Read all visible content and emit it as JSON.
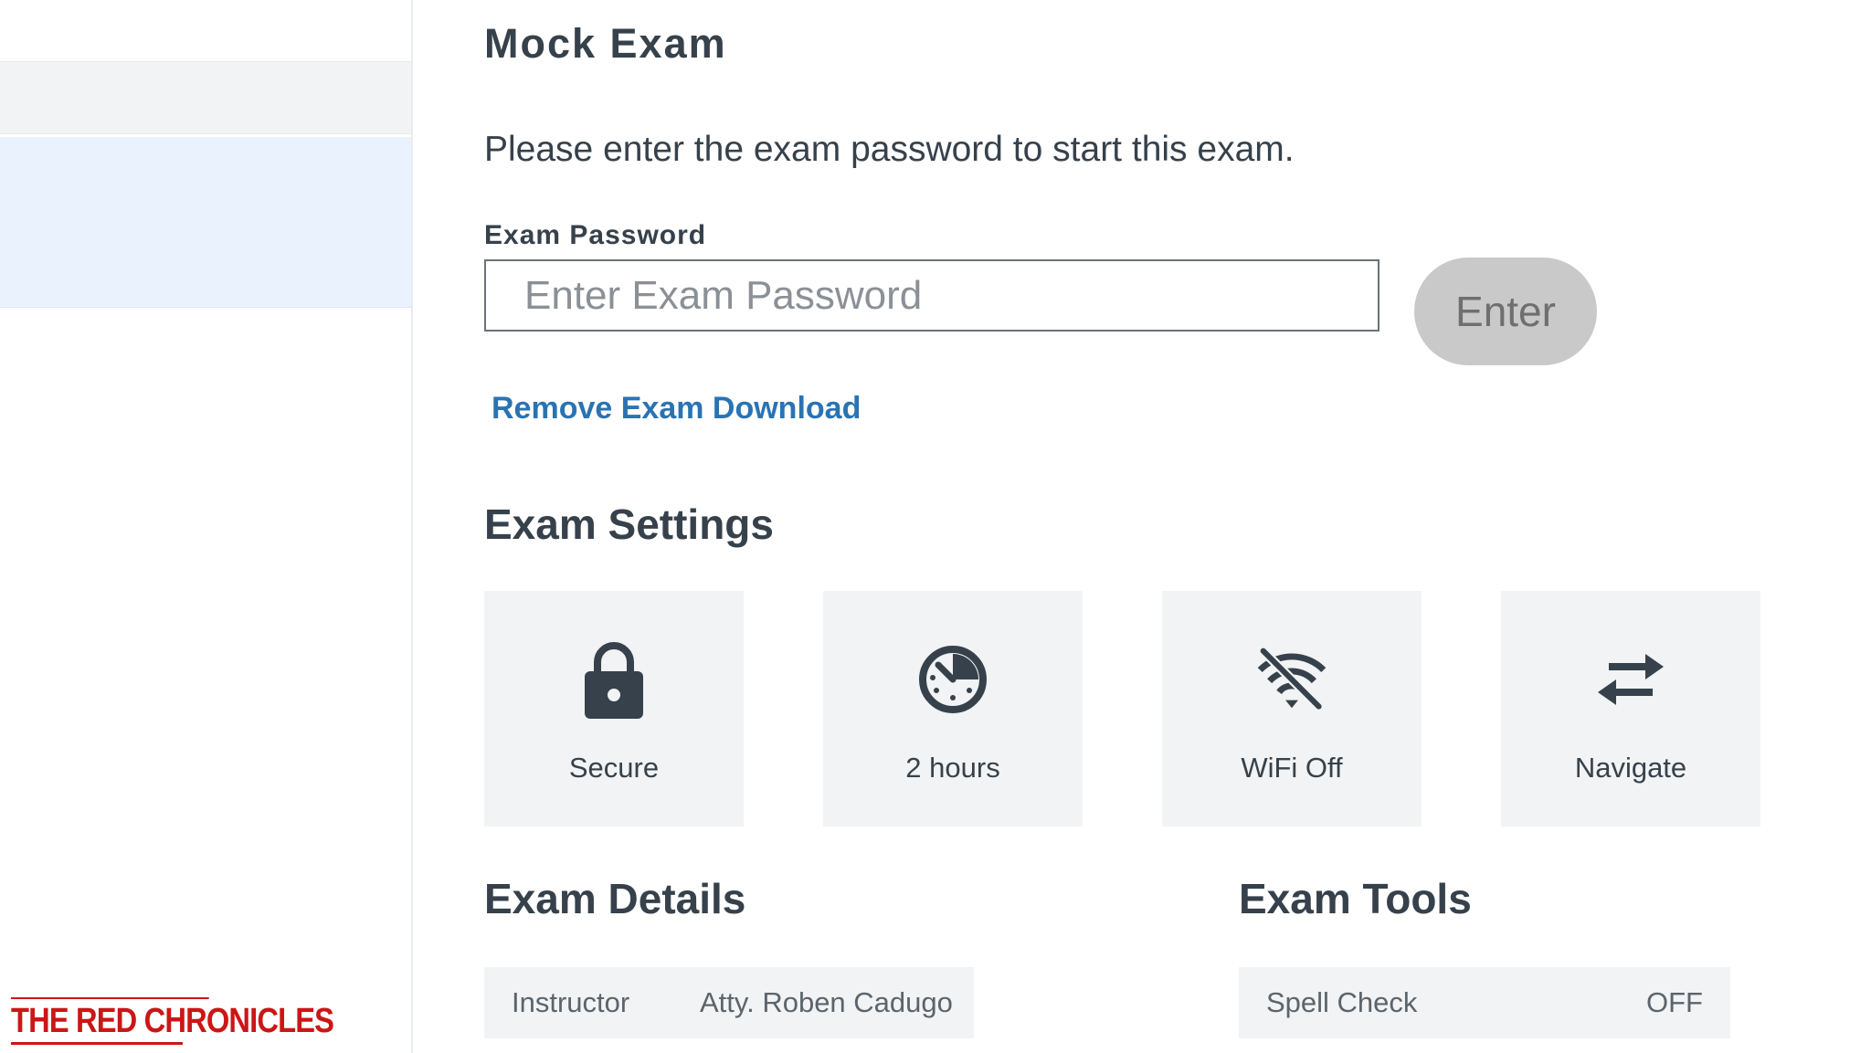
{
  "brand": {
    "logo_text": "THE RED CHRONICLES"
  },
  "exam": {
    "title": "Mock Exam",
    "instructions": "Please enter the exam password to start this exam.",
    "password_label": "Exam Password",
    "password_placeholder": "Enter Exam Password",
    "password_value": "",
    "enter_label": "Enter",
    "remove_download_label": "Remove Exam Download"
  },
  "settings": {
    "heading": "Exam Settings",
    "tiles": [
      {
        "icon": "lock-icon",
        "label": "Secure"
      },
      {
        "icon": "timer-icon",
        "label": "2 hours"
      },
      {
        "icon": "wifi-off-icon",
        "label": "WiFi Off"
      },
      {
        "icon": "swap-arrows-icon",
        "label": "Navigate"
      }
    ]
  },
  "details": {
    "heading": "Exam Details",
    "rows": [
      {
        "key": "Instructor",
        "value": "Atty. Roben Cadugo"
      }
    ]
  },
  "tools": {
    "heading": "Exam Tools",
    "rows": [
      {
        "key": "Spell Check",
        "value": "OFF"
      }
    ]
  },
  "colors": {
    "text": "#36414b",
    "link": "#2a73b3",
    "tile_bg": "#f2f3f4",
    "selected_row": "#eaf3fd",
    "button_disabled": "#c9c9c9",
    "logo_red": "#cc1616"
  }
}
